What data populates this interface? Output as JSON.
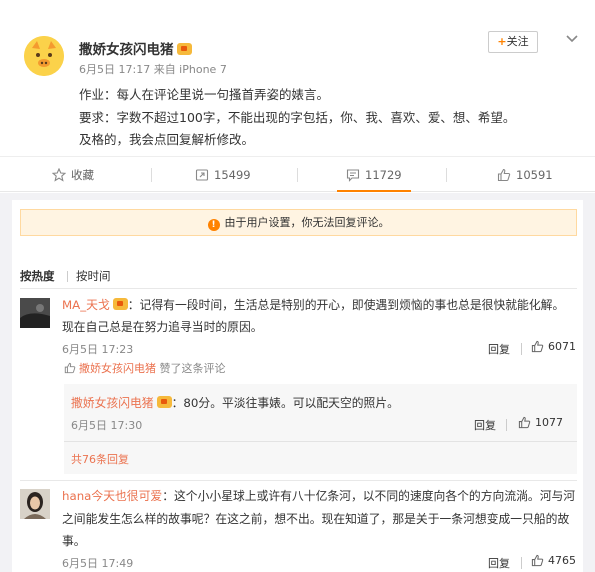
{
  "post": {
    "username": "撒娇女孩闪电猪",
    "meta": "6月5日 17:17 来自 iPhone 7",
    "follow_label": "关注",
    "lines": [
      "作业：每人在评论里说一句搔首弄姿的婊言。",
      "要求：字数不超过100字，不能出现的字包括，你、我、喜欢、爱、想、希望。",
      "及格的，我会点回复解析修改。"
    ]
  },
  "actions": {
    "favorite": "收藏",
    "repost": "15499",
    "comment": "11729",
    "like": "10591"
  },
  "notice": "由于用户设置，你无法回复评论。",
  "sort": {
    "hot": "按热度",
    "time": "按时间"
  },
  "comments": [
    {
      "user": "MA_天戈",
      "line1": "：记得有一段时间，生活总是特别的开心，即使遇到烦恼的事也总是很快就能化解。",
      "line2": "现在自己总是在努力追寻当时的原因。",
      "time": "6月5日 17:23",
      "reply": "回复",
      "likes": "6071",
      "liked_by_user": "撒娇女孩闪电猪",
      "liked_by_text": " 赞了这条评论",
      "sub_reply": {
        "user": "撒娇女孩闪电猪",
        "text": "：80分。平淡往事婊。可以配天空的照片。",
        "time": "6月5日 17:30",
        "reply": "回复",
        "likes": "1077"
      },
      "more_replies": "共76条回复"
    },
    {
      "user": "hana今天也很可爱",
      "line1": "：这个小小星球上或许有八十亿条河，以不同的速度向各个的方向流淌。河与河",
      "line2": "之间能发生怎么样的故事呢？在这之前，想不出。现在知道了，那是关于一条河想变成一只船的故",
      "line3": "事。",
      "time": "6月5日 17:49",
      "reply": "回复",
      "likes": "4765"
    }
  ],
  "colors": {
    "accent": "#ff8200",
    "username_link": "#eb7350",
    "notice_bg": "#fff4e2",
    "page_grey": "#f2f2f5"
  }
}
